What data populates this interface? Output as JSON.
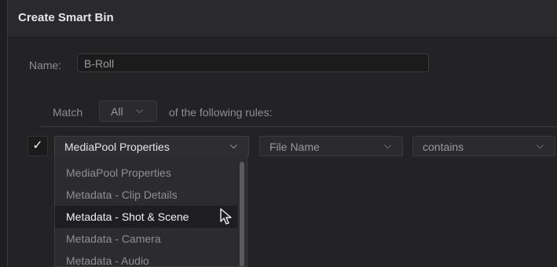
{
  "dialog": {
    "title": "Create Smart Bin"
  },
  "name": {
    "label": "Name:",
    "value": "B-Roll"
  },
  "match": {
    "label": "Match",
    "selected": "All",
    "suffix": "of the following rules:"
  },
  "rule": {
    "checked_mark": "✓",
    "property": "MediaPool Properties",
    "field": "File Name",
    "operator": "contains"
  },
  "dropdown_menu": {
    "items": [
      "MediaPool Properties",
      "Metadata - Clip Details",
      "Metadata - Shot & Scene",
      "Metadata - Camera",
      "Metadata - Audio"
    ],
    "highlighted_index": 2
  },
  "icons": {
    "chevron": "chevron-down-icon",
    "check": "checkmark-icon",
    "cursor": "mouse-pointer-icon"
  }
}
